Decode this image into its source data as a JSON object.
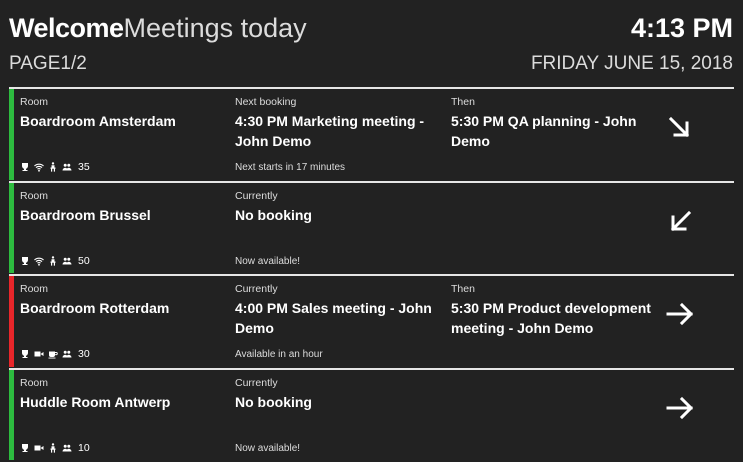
{
  "header": {
    "welcome": "Welcome",
    "subtitle": "Meetings today",
    "page_prefix": "PAGE",
    "page": "1/2",
    "time": "4:13 PM",
    "date": "FRIDAY JUNE 15, 2018"
  },
  "colors": {
    "available": "#2dbb3f",
    "occupied": "#e8262a"
  },
  "rooms": [
    {
      "room_label": "Room",
      "name": "Boardroom Amsterdam",
      "status": "available",
      "mid_label": "Next booking",
      "mid_value": "4:30 PM Marketing meeting - John Demo",
      "then_label": "Then",
      "then_value": "5:30 PM QA planning - John Demo",
      "note": "Next starts in 17 minutes",
      "amenities": [
        "trophy-icon",
        "wifi-icon",
        "accessible-icon",
        "people-icon"
      ],
      "capacity": "35",
      "arrow": "arrow-down-right-icon"
    },
    {
      "room_label": "Room",
      "name": "Boardroom Brussel",
      "status": "available",
      "mid_label": "Currently",
      "mid_value": "No booking",
      "then_label": "",
      "then_value": "",
      "note": "Now available!",
      "amenities": [
        "trophy-icon",
        "wifi-icon",
        "accessible-icon",
        "people-icon"
      ],
      "capacity": "50",
      "arrow": "arrow-down-left-icon"
    },
    {
      "room_label": "Room",
      "name": "Boardroom Rotterdam",
      "status": "occupied",
      "mid_label": "Currently",
      "mid_value": "4:00 PM Sales meeting - John Demo",
      "then_label": "Then",
      "then_value": "5:30 PM Product development meeting - John Demo",
      "note": "Available in an hour",
      "amenities": [
        "trophy-icon",
        "video-icon",
        "coffee-icon",
        "people-icon"
      ],
      "capacity": "30",
      "arrow": "arrow-right-icon"
    },
    {
      "room_label": "Room",
      "name": "Huddle Room Antwerp",
      "status": "available",
      "mid_label": "Currently",
      "mid_value": "No booking",
      "then_label": "",
      "then_value": "",
      "note": "Now available!",
      "amenities": [
        "trophy-icon",
        "video-icon",
        "accessible-icon",
        "people-icon"
      ],
      "capacity": "10",
      "arrow": "arrow-right-icon"
    }
  ]
}
